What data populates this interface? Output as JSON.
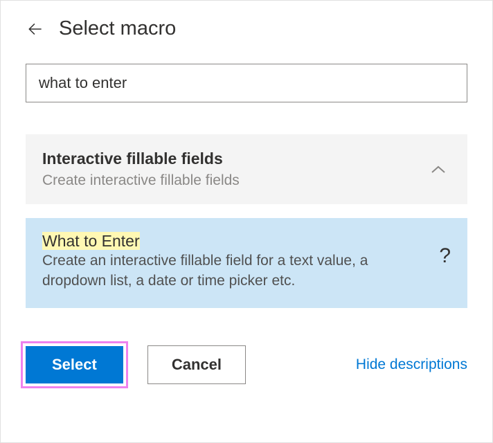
{
  "header": {
    "title": "Select macro"
  },
  "search": {
    "value": "what to enter"
  },
  "category": {
    "title": "Interactive fillable fields",
    "description": "Create interactive fillable fields"
  },
  "macro": {
    "title": "What to Enter",
    "description": "Create an interactive fillable field for a text value, a dropdown list, a date or time picker etc.",
    "help": "?"
  },
  "buttons": {
    "select": "Select",
    "cancel": "Cancel",
    "hide": "Hide descriptions"
  }
}
